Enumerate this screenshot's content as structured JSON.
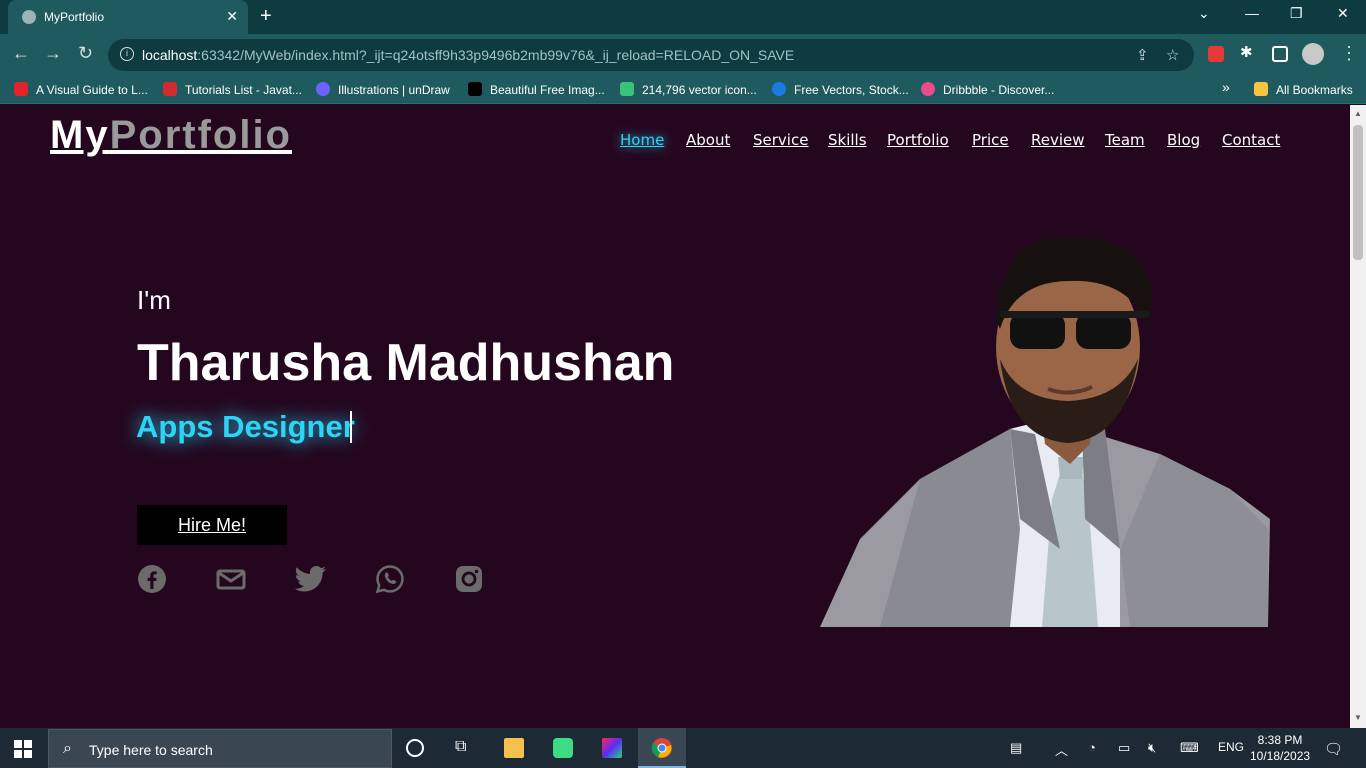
{
  "browser": {
    "tab_title": "MyPortfolio",
    "tab_close": "✕",
    "new_tab": "+",
    "url_host": "localhost",
    "url_rest": ":63342/MyWeb/index.html?_ijt=q24otsff9h33p9496b2mb99v76&_ij_reload=RELOAD_ON_SAVE",
    "bookmarks": [
      {
        "label": "A Visual Guide to L...",
        "color": "#e0242a"
      },
      {
        "label": "Tutorials List - Javat...",
        "color": "#d12b2b"
      },
      {
        "label": "Illustrations | unDraw",
        "color": "#6c63ff"
      },
      {
        "label": "Beautiful Free Imag...",
        "color": "#000000"
      },
      {
        "label": "214,796 vector icon...",
        "color": "#39c27b"
      },
      {
        "label": "Free Vectors, Stock...",
        "color": "#1b7be5"
      },
      {
        "label": "Dribbble - Discover...",
        "color": "#ea4c89"
      }
    ],
    "more_bookmarks": "»",
    "all_bookmarks": "All Bookmarks"
  },
  "page": {
    "logo_part1": "My",
    "logo_part2": "Portfolio",
    "nav": [
      "Home",
      "About",
      "Service",
      "Skills",
      "Portfolio",
      "Price",
      "Review",
      "Team",
      "Blog",
      "Contact"
    ],
    "greeting": "I'm",
    "name": "Tharusha Madhushan",
    "role": "Apps Designer",
    "cta": "Hire Me!",
    "social_icons": [
      "facebook-icon",
      "mail-icon",
      "twitter-icon",
      "whatsapp-icon",
      "instagram-icon"
    ],
    "accent_color": "#2cd5f5",
    "background_color": "#24071f"
  },
  "taskbar": {
    "search_placeholder": "Type here to search",
    "lang": "ENG",
    "time": "8:38 PM",
    "date": "10/18/2023"
  }
}
